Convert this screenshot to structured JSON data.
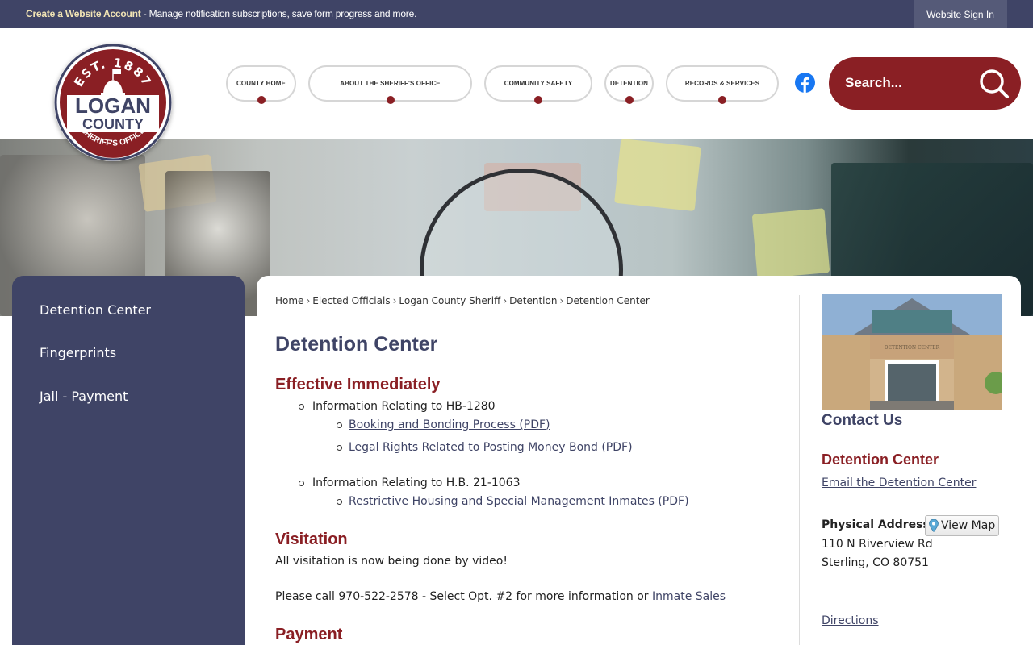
{
  "topbar": {
    "account_link": "Create a Website Account",
    "message": " - Manage notification subscriptions, save form progress and more.",
    "sign_in": "Website Sign In"
  },
  "logo": {
    "est": "EST. 1887",
    "line1": "LOGAN",
    "line2": "COUNTY",
    "ring": "SHERIFF'S OFFICE"
  },
  "nav": [
    {
      "label": "COUNTY HOME"
    },
    {
      "label": "ABOUT THE SHERIFF'S OFFICE"
    },
    {
      "label": "COMMUNITY SAFETY"
    },
    {
      "label": "DETENTION"
    },
    {
      "label": "RECORDS & SERVICES"
    }
  ],
  "search": {
    "placeholder": "Search..."
  },
  "sidebar": {
    "items": [
      {
        "label": "Detention Center"
      },
      {
        "label": "Fingerprints"
      },
      {
        "label": "Jail - Payment"
      }
    ]
  },
  "breadcrumb": [
    "Home",
    "Elected Officials",
    "Logan County Sheriff",
    "Detention",
    "Detention Center"
  ],
  "breadcrumb_sep": "›",
  "page": {
    "title": "Detention Center",
    "effective": {
      "heading": "Effective Immediately",
      "item1": "Information Relating to HB-1280",
      "item1_links": [
        "Booking and Bonding Process (PDF)",
        "Legal Rights Related to Posting Money Bond (PDF)"
      ],
      "item2": "Information Relating to H.B. 21-1063",
      "item2_links": [
        "Restrictive Housing and Special Management Inmates (PDF)"
      ]
    },
    "visitation": {
      "heading": "Visitation",
      "line1": "All visitation is now being done by video!",
      "line2": "Please call 970-522-2578 - Select Opt. #2 for more information or ",
      "line2_link": "Inmate Sales"
    },
    "payment": {
      "heading": "Payment"
    }
  },
  "contact": {
    "photo_sign": "DETENTION CENTER",
    "heading": "Contact Us",
    "org": "Detention Center",
    "email_link": "Email the Detention Center",
    "address_label": "Physical Address",
    "view_map": "View Map",
    "address1": "110 N Riverview Rd",
    "address2": "Sterling, CO 80751",
    "directions": "Directions"
  },
  "colors": {
    "navy": "#3f4466",
    "maroon": "#8a1f24",
    "facebook": "#1877f2"
  },
  "icons": [
    "facebook-icon",
    "search-icon",
    "map-pin-icon",
    "magnifying-glass"
  ]
}
